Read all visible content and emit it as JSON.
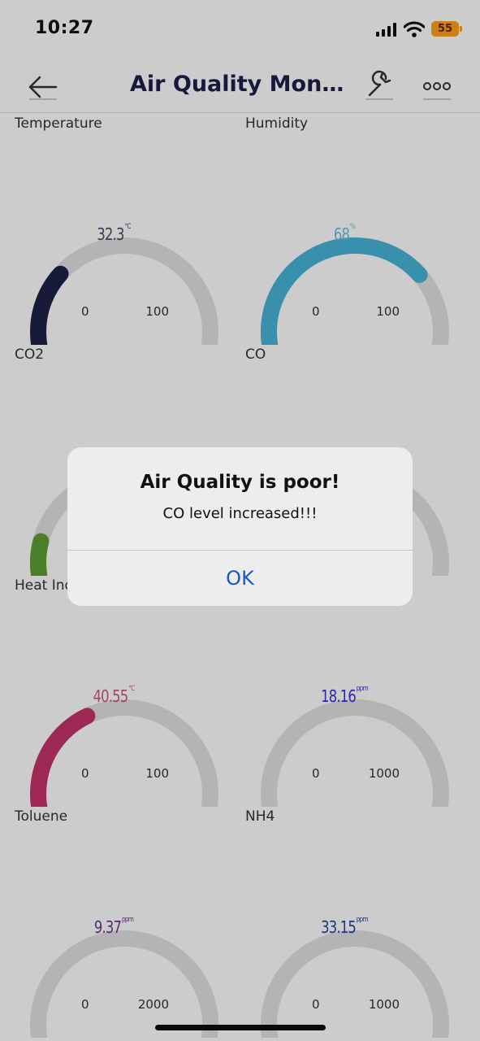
{
  "status_bar": {
    "time": "10:27",
    "battery": "55"
  },
  "nav": {
    "title": "Air Quality Monitor..."
  },
  "colors": {
    "track": "#e1e1e1",
    "battery": "#ff9f1a",
    "accent": "#1a56c4"
  },
  "gauges": [
    {
      "title": "Temperature",
      "value": "32.3",
      "unit": "°C",
      "min": "0",
      "max": "100",
      "level": 0.323,
      "color": "#1f2148",
      "text_color": "#4a4a68"
    },
    {
      "title": "Humidity",
      "value": "68",
      "unit": "%",
      "min": "0",
      "max": "100",
      "level": 0.68,
      "color": "#46b4d8",
      "text_color": "#6cbcd8"
    },
    {
      "title": "CO2",
      "value": "",
      "unit": "",
      "min": "",
      "max": "",
      "level": 0.22,
      "color": "#5e9e34",
      "text_color": "#5e9e34"
    },
    {
      "title": "CO",
      "value": "",
      "unit": "",
      "min": "",
      "max": "",
      "level": 0,
      "color": "#e1e1e1",
      "text_color": "#333333"
    },
    {
      "title": "Heat Index",
      "value": "40.55",
      "unit": "°C",
      "min": "0",
      "max": "100",
      "level": 0.4055,
      "color": "#c5336a",
      "text_color": "#c95a80"
    },
    {
      "title": "",
      "value": "18.16",
      "unit": "ppm",
      "min": "0",
      "max": "1000",
      "level": 0.01816,
      "color": "#1a10d6",
      "text_color": "#3a2ed6"
    },
    {
      "title": "Toluene",
      "value": "9.37",
      "unit": "ppm",
      "min": "0",
      "max": "2000",
      "level": 0.004685,
      "color": "#5a1a78",
      "text_color": "#6a3888"
    },
    {
      "title": "NH4",
      "value": "33.15",
      "unit": "ppm",
      "min": "0",
      "max": "1000",
      "level": 0.03315,
      "color": "#0f2a88",
      "text_color": "#28449a"
    }
  ],
  "alert": {
    "title": "Air Quality is poor!",
    "message": "CO level increased!!!",
    "button": "OK"
  }
}
